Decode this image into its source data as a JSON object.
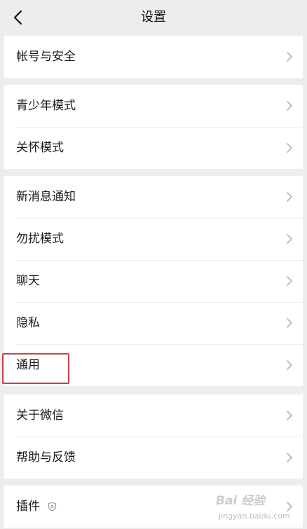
{
  "header": {
    "title": "设置",
    "back_icon": "chevron-left-icon"
  },
  "groups": [
    {
      "items": [
        {
          "label": "帐号与安全"
        }
      ]
    },
    {
      "items": [
        {
          "label": "青少年模式"
        },
        {
          "label": "关怀模式"
        }
      ]
    },
    {
      "items": [
        {
          "label": "新消息通知"
        },
        {
          "label": "勿扰模式"
        },
        {
          "label": "聊天"
        },
        {
          "label": "隐私"
        },
        {
          "label": "通用",
          "highlighted": true
        }
      ]
    },
    {
      "items": [
        {
          "label": "关于微信"
        },
        {
          "label": "帮助与反馈"
        }
      ]
    },
    {
      "items": [
        {
          "label": "插件",
          "icon": "shield-icon"
        }
      ]
    }
  ],
  "colors": {
    "background": "#ededed",
    "cell": "#ffffff",
    "highlight": "#c7434a"
  },
  "watermark": {
    "main": "Bai 经验",
    "sub": "jingyan.baidu.com"
  }
}
